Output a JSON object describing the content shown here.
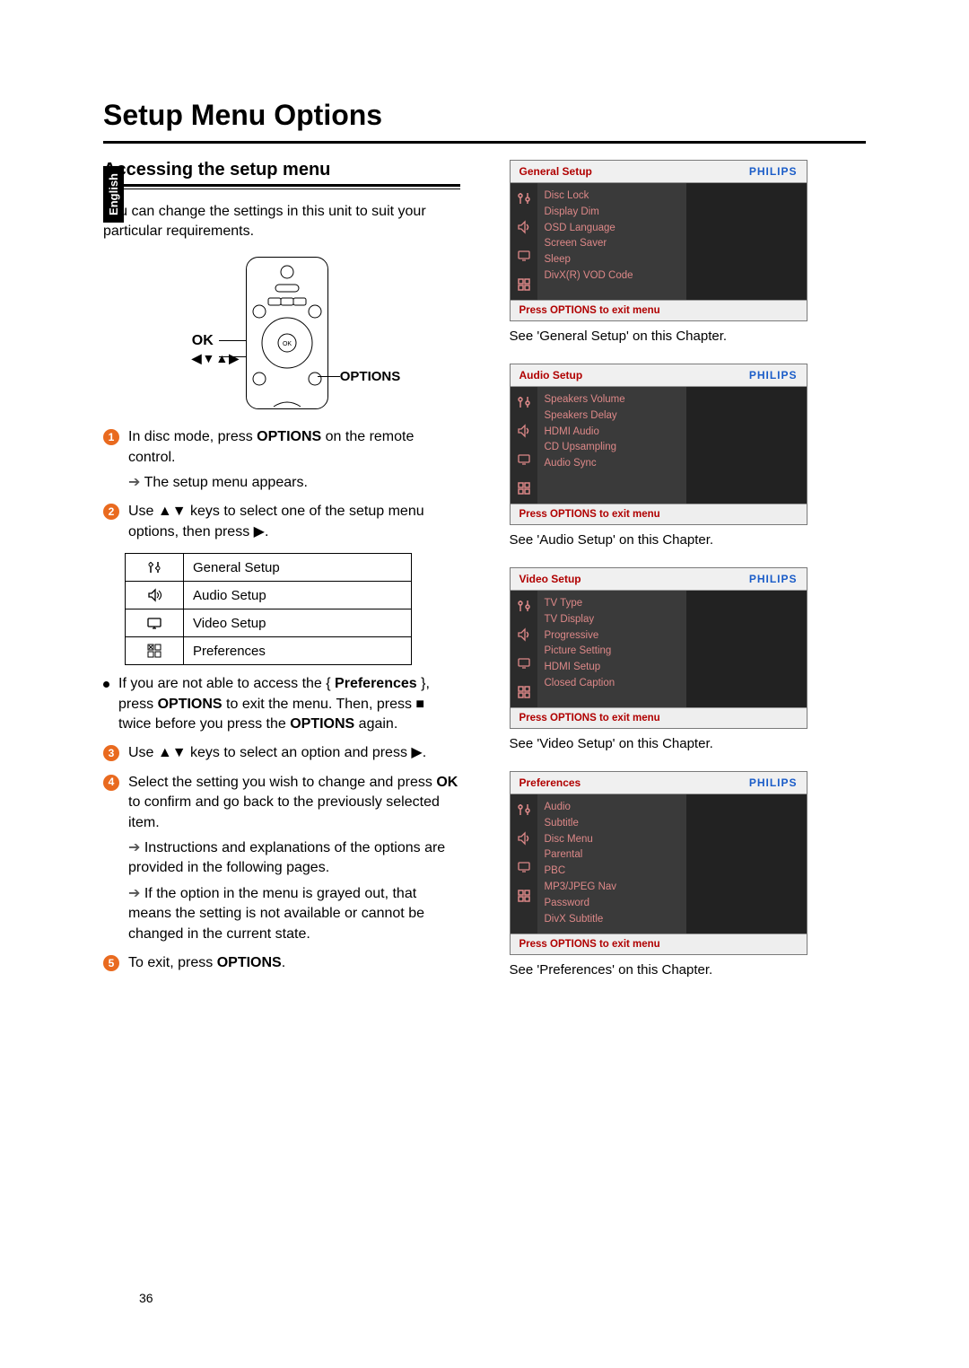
{
  "pageNumber": "36",
  "title": "Setup Menu Options",
  "langTab": "English",
  "section": {
    "heading": "Accessing the setup menu",
    "intro": "You can change the settings in this unit to suit your particular requirements.",
    "remote": {
      "ok": "OK",
      "arrows": "◀▼▲▶",
      "options": "OPTIONS"
    },
    "steps": {
      "s1a": "In disc mode, press ",
      "s1b": "OPTIONS",
      "s1c": " on the remote control.",
      "s1sub": "The setup menu appears.",
      "s2": "Use ▲▼ keys to select one of the setup menu options, then press ▶.",
      "menuTable": [
        "General Setup",
        "Audio Setup",
        "Video Setup",
        "Preferences"
      ],
      "noteA": "If you are not able to access the { ",
      "noteB": "Preferences",
      "noteC": " }, press ",
      "noteD": "OPTIONS",
      "noteE": " to exit the menu. Then, press ■ twice before you press the ",
      "noteF": "OPTIONS",
      "noteG": " again.",
      "s3": "Use ▲▼ keys to select an option and press ▶.",
      "s4a": "Select the setting you wish to change and press ",
      "s4b": "OK",
      "s4c": " to confirm and go back to the previously selected item.",
      "s4sub1": "Instructions and explanations of the options are provided in the following pages.",
      "s4sub2": "If the option in the menu is grayed out, that means the setting is not available or cannot be changed in the current state.",
      "s5a": "To exit, press ",
      "s5b": "OPTIONS",
      "s5c": "."
    }
  },
  "osd": {
    "logo": "PHILIPS",
    "footer": "Press OPTIONS to exit menu",
    "panels": [
      {
        "title": "General Setup",
        "items": [
          "Disc Lock",
          "Display Dim",
          "OSD Language",
          "Screen Saver",
          "Sleep",
          "DivX(R) VOD Code"
        ],
        "caption": "See 'General Setup' on this Chapter."
      },
      {
        "title": "Audio Setup",
        "items": [
          "Speakers Volume",
          "Speakers Delay",
          "HDMI Audio",
          "CD Upsampling",
          "Audio Sync"
        ],
        "caption": "See 'Audio Setup' on this Chapter."
      },
      {
        "title": "Video Setup",
        "items": [
          "TV Type",
          "TV Display",
          "Progressive",
          "Picture Setting",
          "HDMI Setup",
          "Closed Caption"
        ],
        "caption": "See 'Video Setup' on this Chapter."
      },
      {
        "title": "Preferences",
        "items": [
          "Audio",
          "Subtitle",
          "Disc Menu",
          "Parental",
          "PBC",
          "MP3/JPEG Nav",
          "Password",
          "DivX Subtitle"
        ],
        "caption": "See 'Preferences' on this Chapter."
      }
    ]
  }
}
